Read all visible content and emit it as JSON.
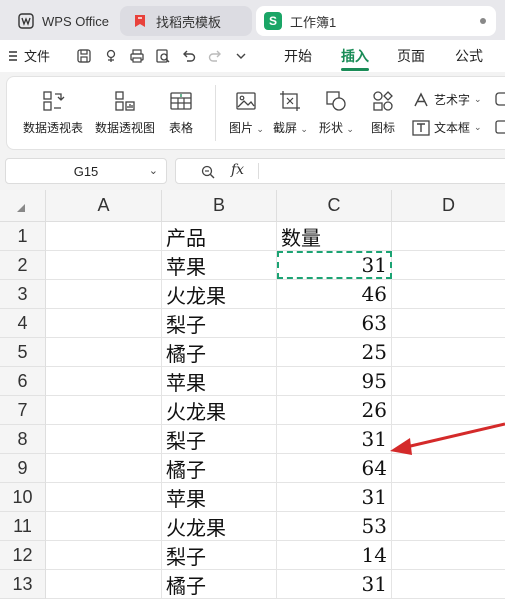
{
  "tabs": {
    "wps": "WPS Office",
    "templates": "找稻壳模板",
    "workbook": "工作簿1",
    "workbook_logo": "S"
  },
  "menu": {
    "file": "文件",
    "tabs": [
      "开始",
      "插入",
      "页面",
      "公式"
    ],
    "active_tab": "插入"
  },
  "ribbon": {
    "pivot_table": "数据透视表",
    "pivot_chart": "数据透视图",
    "table": "表格",
    "picture": "图片",
    "screenshot": "截屏",
    "shape": "形状",
    "icon": "图标",
    "wordart": "艺术字",
    "textbox": "文本框"
  },
  "formula_bar": {
    "cell_ref": "G15",
    "fx": "fx",
    "content": ""
  },
  "sheet": {
    "columns": [
      "A",
      "B",
      "C",
      "D"
    ],
    "rows": [
      {
        "n": "1",
        "b": "产品",
        "c": "数量"
      },
      {
        "n": "2",
        "b": "苹果",
        "c": "31"
      },
      {
        "n": "3",
        "b": "火龙果",
        "c": "46"
      },
      {
        "n": "4",
        "b": "梨子",
        "c": "63"
      },
      {
        "n": "5",
        "b": "橘子",
        "c": "25"
      },
      {
        "n": "6",
        "b": "苹果",
        "c": "95"
      },
      {
        "n": "7",
        "b": "火龙果",
        "c": "26"
      },
      {
        "n": "8",
        "b": "梨子",
        "c": "31"
      },
      {
        "n": "9",
        "b": "橘子",
        "c": "64"
      },
      {
        "n": "10",
        "b": "苹果",
        "c": "31"
      },
      {
        "n": "11",
        "b": "火龙果",
        "c": "53"
      },
      {
        "n": "12",
        "b": "梨子",
        "c": "14"
      },
      {
        "n": "13",
        "b": "橘子",
        "c": "31"
      }
    ]
  },
  "colors": {
    "accent": "#1a8c57",
    "marquee": "#1ba373",
    "arrow": "#d42a2a"
  }
}
